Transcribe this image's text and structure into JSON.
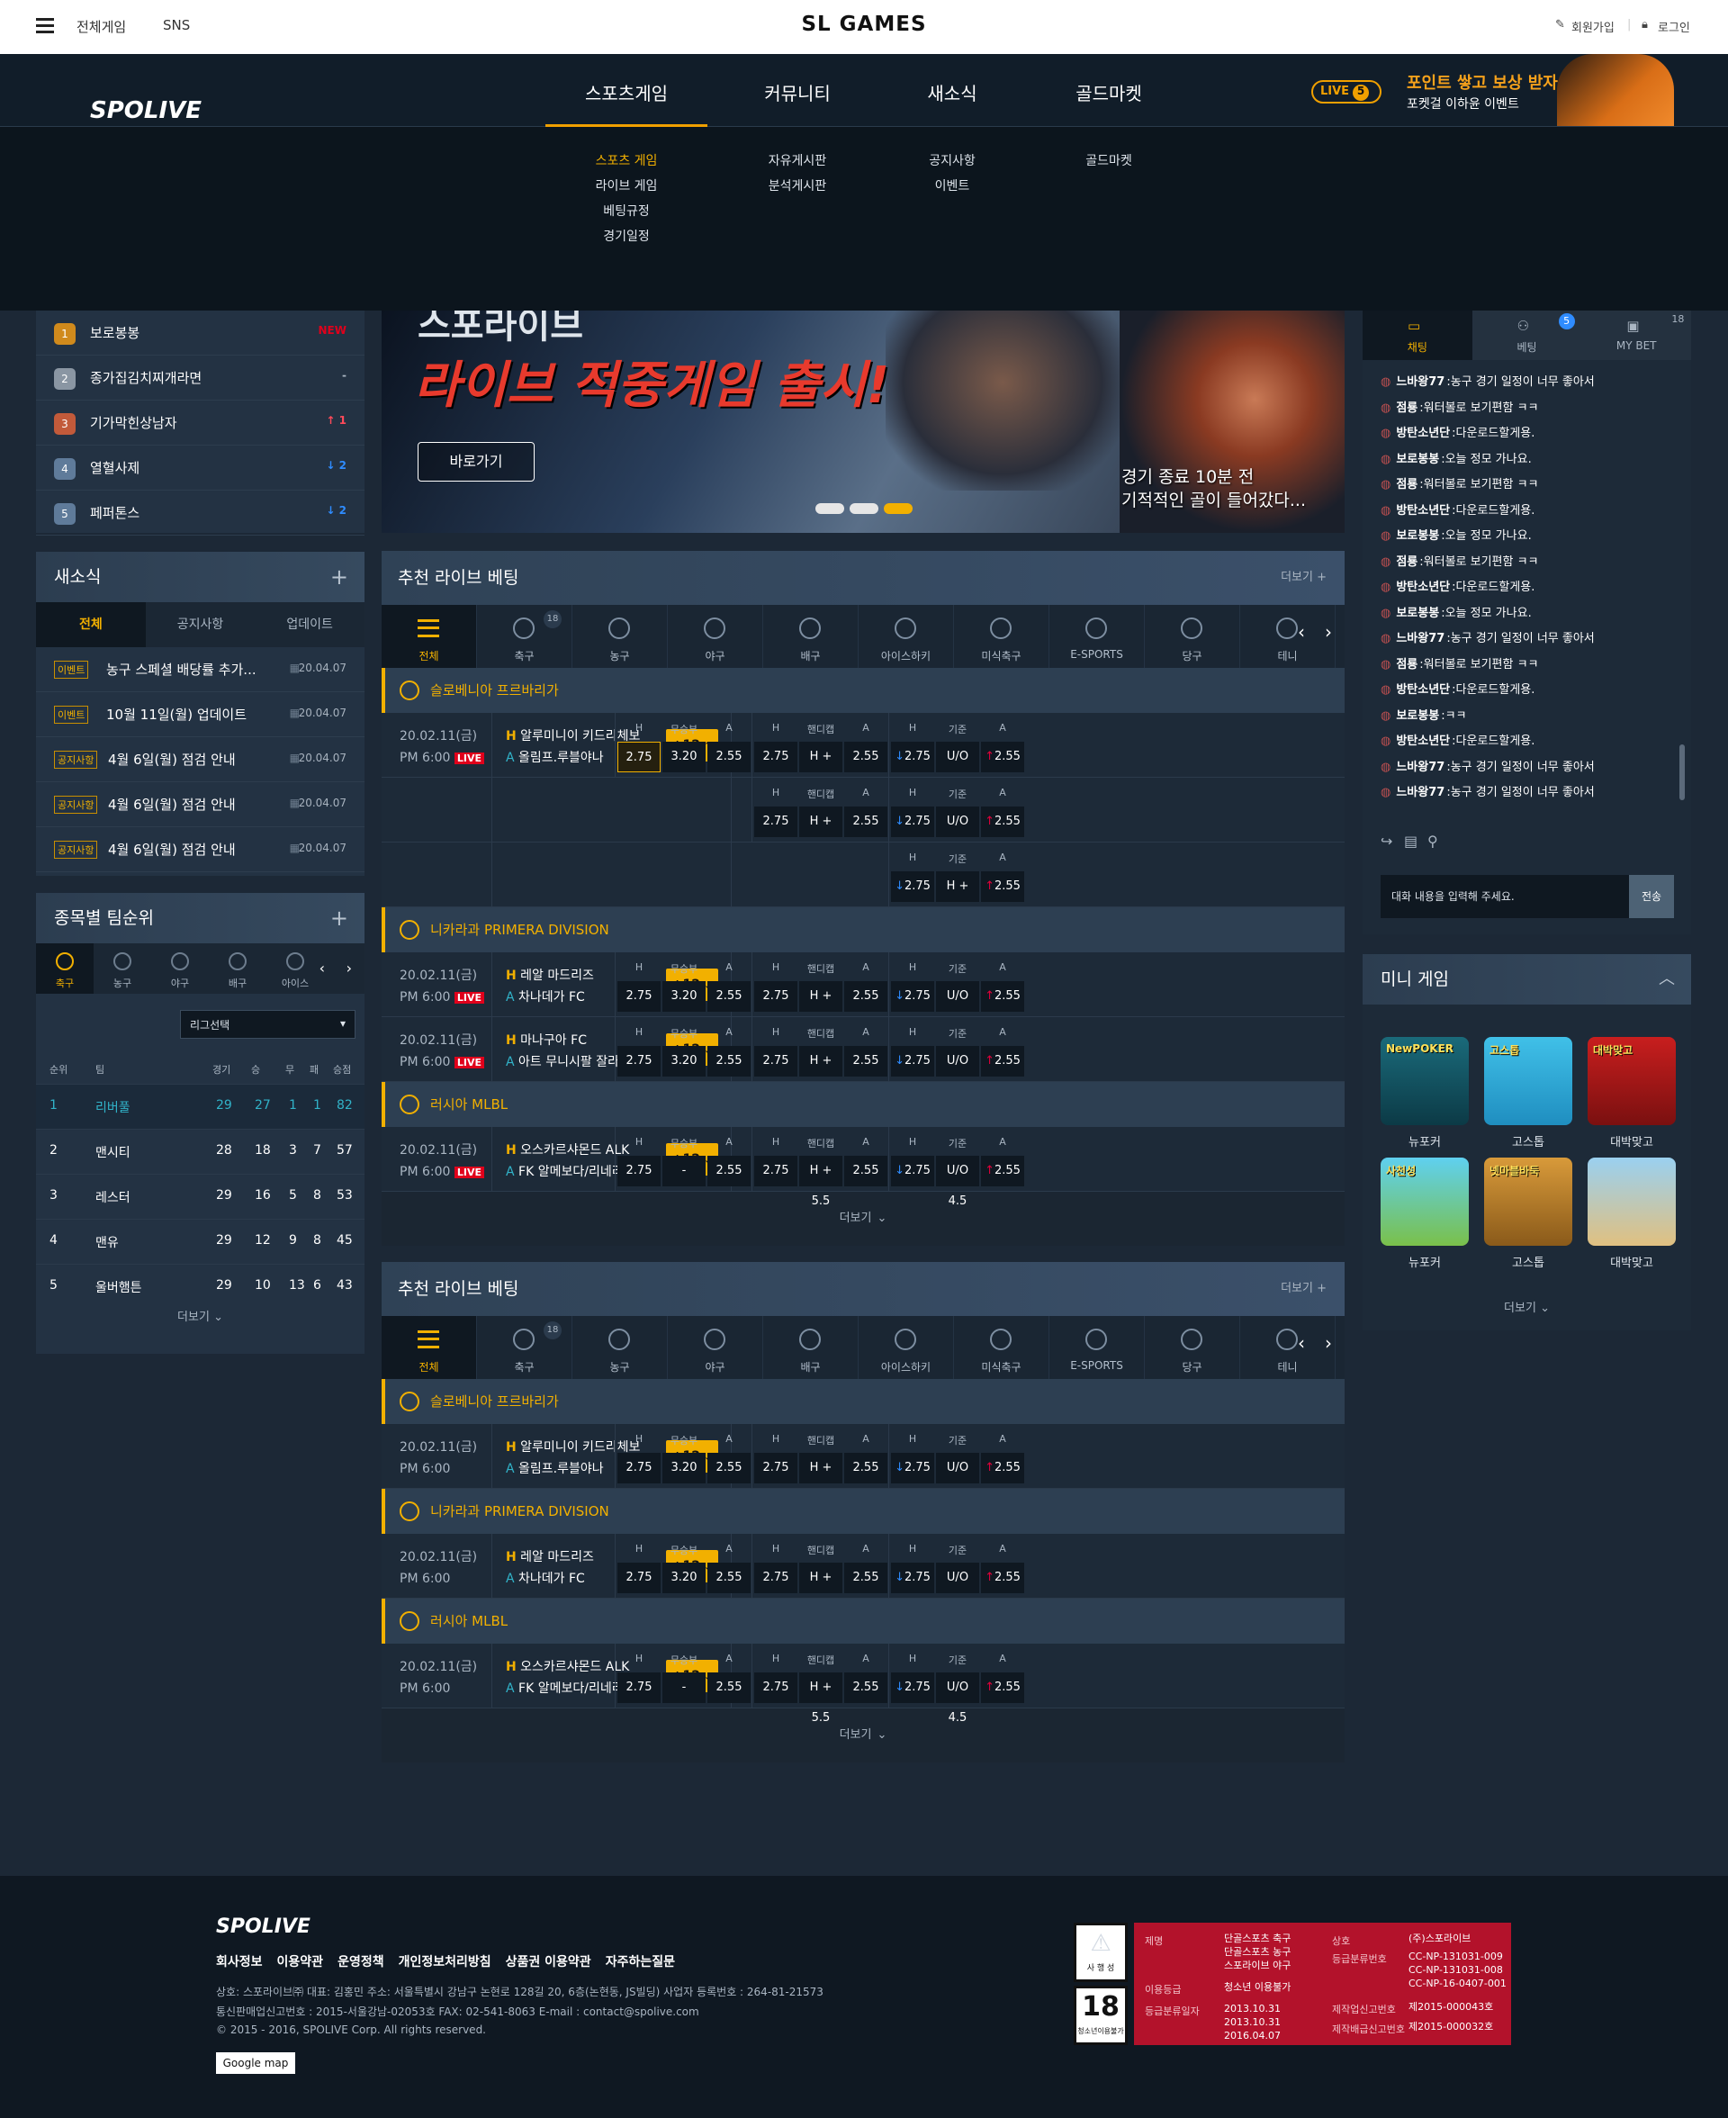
{
  "topbar": {
    "all_games": "전체게임",
    "sns": "SNS",
    "brand": "SL GAMES",
    "signup": "회원가입",
    "login": "로그인"
  },
  "nav": {
    "logo": "SPOLIVE",
    "items": [
      "스포츠게임",
      "커뮤니티",
      "새소식",
      "골드마켓"
    ],
    "live_label": "LIVE",
    "live_count": "5",
    "promo_title": "포인트 쌓고 보상 받자!",
    "promo_sub": "포켓걸 이하윤 이벤트"
  },
  "dropdown": {
    "sports": [
      "스포츠 게임",
      "라이브 게임",
      "베팅규정",
      "경기일정"
    ],
    "community": [
      "자유게시판",
      "분석게시판"
    ],
    "news": [
      "공지사항",
      "이벤트"
    ],
    "gold": [
      "골드마켓"
    ]
  },
  "ranking": [
    {
      "rank": "1",
      "name": "보로봉봉",
      "change": "NEW"
    },
    {
      "rank": "2",
      "name": "종가집김치찌개라면",
      "change": "-"
    },
    {
      "rank": "3",
      "name": "기가막힌상남자",
      "change": "↑ 1"
    },
    {
      "rank": "4",
      "name": "열혈사제",
      "change": "↓ 2"
    },
    {
      "rank": "5",
      "name": "페퍼톤스",
      "change": "↓ 2"
    }
  ],
  "banner": {
    "title_top": "스포라이브",
    "title_main": "라이브 적중게임 출시!",
    "button": "바로가기",
    "caption1": "경기 종료 10분 전",
    "caption2": "기적적인 골이 들어갔다..."
  },
  "news": {
    "title": "새소식",
    "plus": "+",
    "tabs": [
      "전체",
      "공지사항",
      "업데이트"
    ],
    "items": [
      {
        "tag": "이벤트",
        "title": "농구 스페셜 배당률 추가...",
        "date": "20.04.07"
      },
      {
        "tag": "이벤트",
        "title": "10월 11일(월) 업데이트",
        "date": "20.04.07"
      },
      {
        "tag": "공지사항",
        "title": "4월 6일(월) 점검 안내",
        "date": "20.04.07"
      },
      {
        "tag": "공지사항",
        "title": "4월 6일(월) 점검 안내",
        "date": "20.04.07"
      },
      {
        "tag": "공지사항",
        "title": "4월 6일(월) 점검 안내",
        "date": "20.04.07"
      }
    ]
  },
  "team_rank": {
    "title": "종목별 팀순위",
    "plus": "+",
    "sports": [
      "축구",
      "농구",
      "야구",
      "배구",
      "아이스"
    ],
    "league_select": "리그선택",
    "headers": [
      "순위",
      "팀",
      "경기",
      "승",
      "무",
      "패",
      "승점"
    ],
    "rows": [
      [
        "1",
        "리버풀",
        "29",
        "27",
        "1",
        "1",
        "82"
      ],
      [
        "2",
        "맨시티",
        "28",
        "18",
        "3",
        "7",
        "57"
      ],
      [
        "3",
        "레스터",
        "29",
        "16",
        "5",
        "8",
        "53"
      ],
      [
        "4",
        "맨유",
        "29",
        "12",
        "9",
        "8",
        "45"
      ],
      [
        "5",
        "울버햄튼",
        "29",
        "10",
        "13",
        "6",
        "43"
      ]
    ],
    "more": "더보기"
  },
  "sport_tabs": [
    "전체",
    "축구",
    "농구",
    "야구",
    "배구",
    "아이스하키",
    "미식축구",
    "E-SPORTS",
    "당구",
    "테니"
  ],
  "sport_badge": "18",
  "section1": {
    "title": "추천 라이브 베팅",
    "more": "더보기 +",
    "more_bottom": "더보기",
    "leagues": [
      {
        "name": "슬로베니아 프르바리가",
        "matches": [
          {
            "date": "20.02.11(금)",
            "time": "PM 6:00",
            "live": "LIVE",
            "home": "알루미니이 키드리체보",
            "away": "올림프.루블야나",
            "plus": "+12",
            "odds": [
              [
                "2.75",
                "3.20",
                "2.55"
              ],
              [
                "2.75",
                "H + 5.5",
                "2.55"
              ],
              [
                "2.75",
                "U/O 4.5",
                "2.55"
              ]
            ]
          },
          {
            "odds": [
              [
                "2.75",
                "H + 5.5",
                "2.55"
              ],
              [
                "2.75",
                "U/O 4.5",
                "2.55"
              ]
            ]
          },
          {
            "odds": [
              [
                "2.75",
                "H + 5.5",
                "2.55"
              ]
            ]
          }
        ]
      },
      {
        "name": "니카라과 PRIMERA DIVISION",
        "matches": [
          {
            "date": "20.02.11(금)",
            "time": "PM 6:00",
            "live": "LIVE",
            "home": "레알 마드리즈",
            "away": "차나데가 FC",
            "plus": "+12",
            "odds": [
              [
                "2.75",
                "3.20",
                "2.55"
              ],
              [
                "2.75",
                "H + 5.5",
                "2.55"
              ],
              [
                "2.75",
                "U/O 4.5",
                "2.55"
              ]
            ]
          },
          {
            "date": "20.02.11(금)",
            "time": "PM 6:00",
            "live": "LIVE",
            "home": "마나구아 FC",
            "away": "아트 무니시팔 잘라파",
            "plus": "+12",
            "odds": [
              [
                "2.75",
                "3.20",
                "2.55"
              ],
              [
                "2.75",
                "H + 5.5",
                "2.55"
              ],
              [
                "2.75",
                "U/O 4.5",
                "2.55"
              ]
            ]
          }
        ]
      },
      {
        "name": "러시아 MLBL",
        "matches": [
          {
            "date": "20.02.11(금)",
            "time": "PM 6:00",
            "live": "LIVE",
            "home": "오스카르샤몬드 ALK",
            "away": "FK 알메보다/리네리드",
            "plus": "+12",
            "odds": [
              [
                "2.75",
                "-",
                "2.55"
              ],
              [
                "2.75",
                "H + 5.5",
                "2.55"
              ],
              [
                "2.75",
                "U/O 4.5",
                "2.55"
              ]
            ]
          }
        ]
      }
    ]
  },
  "section2": {
    "title": "추천 라이브 베팅",
    "more": "더보기 +",
    "more_bottom": "더보기",
    "leagues": [
      {
        "name": "슬로베니아 프르바리가",
        "matches": [
          {
            "date": "20.02.11(금)",
            "time": "PM 6:00",
            "home": "알루미니이 키드리체보",
            "away": "올림프.루블야나",
            "plus": "+12",
            "odds": [
              [
                "2.75",
                "3.20",
                "2.55"
              ],
              [
                "2.75",
                "H + 5.5",
                "2.55"
              ],
              [
                "2.75",
                "U/O 4.5",
                "2.55"
              ]
            ]
          }
        ]
      },
      {
        "name": "니카라과 PRIMERA DIVISION",
        "matches": [
          {
            "date": "20.02.11(금)",
            "time": "PM 6:00",
            "home": "레알 마드리즈",
            "away": "차나데가 FC",
            "plus": "+12",
            "odds": [
              [
                "2.75",
                "3.20",
                "2.55"
              ],
              [
                "2.75",
                "H + 5.5",
                "2.55"
              ],
              [
                "2.75",
                "U/O 4.5",
                "2.55"
              ]
            ]
          }
        ]
      },
      {
        "name": "러시아 MLBL",
        "matches": [
          {
            "date": "20.02.11(금)",
            "time": "PM 6:00",
            "home": "오스카르샤몬드 ALK",
            "away": "FK 알메보다/리네리드",
            "plus": "+12",
            "odds": [
              [
                "2.75",
                "-",
                "2.55"
              ],
              [
                "2.75",
                "H + 5.5",
                "2.55"
              ],
              [
                "2.75",
                "U/O 4.5",
                "2.55"
              ]
            ]
          }
        ]
      }
    ]
  },
  "odds_headers": [
    [
      "H",
      "무승부",
      "A"
    ],
    [
      "H",
      "핸디캡",
      "A"
    ],
    [
      "H",
      "기준",
      "A"
    ]
  ],
  "home_prefix": "H",
  "away_prefix": "A",
  "chat": {
    "tabs": [
      "채팅",
      "베팅",
      "MY BET"
    ],
    "betting_badge": "5",
    "mybet_badge": "18",
    "lines": [
      [
        "느바왕77",
        "농구 경기 일정이 너무 좋아서"
      ],
      [
        "점룡",
        "워터볼로 보기편함 ㅋㅋ"
      ],
      [
        "방탄소년단",
        "다운로드할게용."
      ],
      [
        "보로봉봉",
        "오늘 정모 가나요."
      ],
      [
        "점룡",
        "워터볼로 보기편함 ㅋㅋ"
      ],
      [
        "방탄소년단",
        "다운로드할게용."
      ],
      [
        "보로봉봉",
        "오늘 정모 가나요."
      ],
      [
        "점룡",
        "워터볼로 보기편함 ㅋㅋ"
      ],
      [
        "방탄소년단",
        "다운로드할게용."
      ],
      [
        "보로봉봉",
        "오늘 정모 가나요."
      ],
      [
        "느바왕77",
        "농구 경기 일정이 너무 좋아서"
      ],
      [
        "점룡",
        "워터볼로 보기편함 ㅋㅋ"
      ],
      [
        "방탄소년단",
        "다운로드할게용."
      ],
      [
        "보로봉봉",
        "ㅋㅋ"
      ],
      [
        "방탄소년단",
        "다운로드할게용."
      ],
      [
        "느바왕77",
        "농구 경기 일정이 너무 좋아서"
      ],
      [
        "느바왕77",
        "농구 경기 일정이 너무 좋아서"
      ]
    ],
    "placeholder": "대화 내용을 입력해 주세요.",
    "send": "전송"
  },
  "mini": {
    "title": "미니 게임",
    "games": [
      "뉴포커",
      "고스톱",
      "대박맞고",
      "뉴포커",
      "고스톱",
      "대박맞고"
    ],
    "tile_texts": [
      "NewPOKER",
      "고스톱",
      "대박맞고",
      "사천성",
      "넷마블바둑",
      ""
    ],
    "more": "더보기"
  },
  "footer": {
    "logo": "SPOLIVE",
    "links": [
      "회사정보",
      "이용약관",
      "운영정책",
      "개인정보처리방침",
      "상품권 이용약관",
      "자주하는질문"
    ],
    "info1": "상호: 스포라이브㈜   대표: 김홍민   주소: 서울특별시 강남구 논현로 128길 20, 6층(논현동, JS빌딩)   사업자 등록번호 : 264-81-21573",
    "info2": "통신판매업신고번호 : 2015-서울강남-02053호   FAX: 02-541-8063   E-mail : contact@spolive.com",
    "info3": "© 2015 - 2016, SPOLIVE Corp. All rights reserved.",
    "gmap": "Google map",
    "rating": {
      "k1": "제명",
      "v1": "단골스포츠 축구\n단골스포츠 농구\n스포라이브 야구",
      "k2": "이용등급",
      "v2": "청소년 이용불가",
      "k3": "등급분류일자",
      "v3": "2013.10.31\n2013.10.31\n2016.04.07",
      "k4": "상호",
      "v4": "(주)스포라이브",
      "k5": "등급분류번호",
      "v5": "CC-NP-131031-009\nCC-NP-131031-008\nCC-NP-16-0407-001",
      "k6": "제작업신고번호",
      "v6": "제2015-000043호",
      "k7": "제작배급신고번호",
      "v7": "제2015-000032호",
      "badge1": "사 행 성",
      "badge2": "18",
      "badge3": "청소년이용불가"
    }
  }
}
